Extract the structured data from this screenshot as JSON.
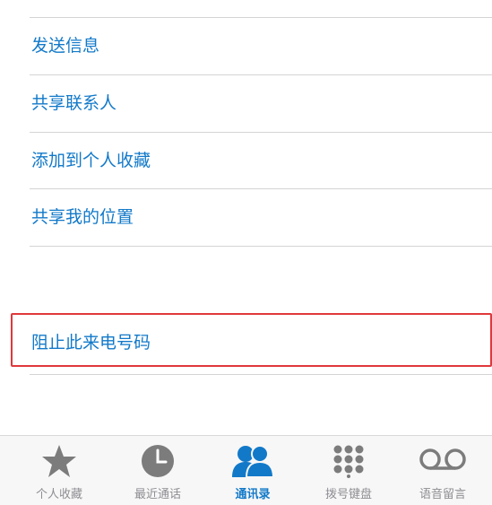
{
  "menu": {
    "items": [
      {
        "label": "发送信息"
      },
      {
        "label": "共享联系人"
      },
      {
        "label": "添加到个人收藏"
      },
      {
        "label": "共享我的位置"
      }
    ],
    "block_label": "阻止此来电号码"
  },
  "tabbar": {
    "tabs": [
      {
        "label": "个人收藏",
        "icon": "star-icon",
        "active": false
      },
      {
        "label": "最近通话",
        "icon": "clock-icon",
        "active": false
      },
      {
        "label": "通讯录",
        "icon": "contacts-icon",
        "active": true
      },
      {
        "label": "拨号键盘",
        "icon": "keypad-icon",
        "active": false
      },
      {
        "label": "语音留言",
        "icon": "voicemail-icon",
        "active": false
      }
    ]
  },
  "colors": {
    "accent": "#1279c9",
    "inactive_tab": "#8e8e93",
    "highlight_border": "#e0383b",
    "separator": "#d4d4d4"
  }
}
